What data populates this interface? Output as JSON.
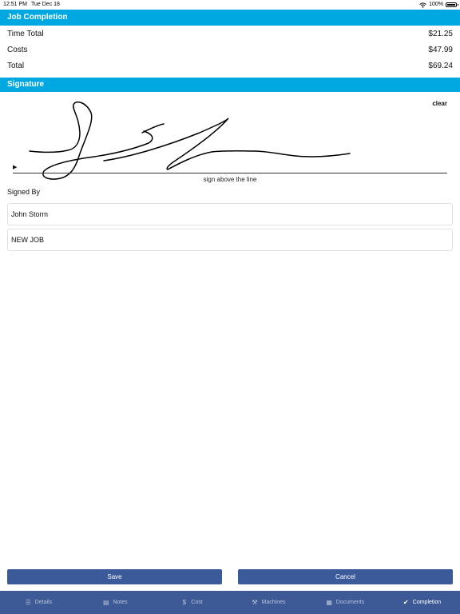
{
  "status_bar": {
    "time": "12:51 PM",
    "date": "Tue Dec 18",
    "battery": "100%"
  },
  "job_completion": {
    "title": "Job Completion",
    "rows": [
      {
        "label": "Time Total",
        "value": "$21.25"
      },
      {
        "label": "Costs",
        "value": "$47.99"
      },
      {
        "label": "Total",
        "value": "$69.24"
      }
    ]
  },
  "signature": {
    "title": "Signature",
    "clear_label": "clear",
    "marker": "▶",
    "hint": "sign above the line"
  },
  "signed_by": {
    "label": "Signed By",
    "name_value": "John Storm",
    "job_value": "NEW JOB"
  },
  "actions": {
    "save_label": "Save",
    "cancel_label": "Cancel"
  },
  "tabs": [
    {
      "label": "Details",
      "icon": "list-icon",
      "glyph": "☰"
    },
    {
      "label": "Notes",
      "icon": "notes-icon",
      "glyph": "▤"
    },
    {
      "label": "Cost",
      "icon": "dollar-icon",
      "glyph": "$"
    },
    {
      "label": "Machines",
      "icon": "wrench-icon",
      "glyph": "⚒"
    },
    {
      "label": "Documents",
      "icon": "document-icon",
      "glyph": "▦"
    },
    {
      "label": "Completion",
      "icon": "checkmark-icon",
      "glyph": "✔"
    }
  ],
  "active_tab": "Completion",
  "colors": {
    "section_header": "#00a8e2",
    "button": "#3a5a9a",
    "tab_bar": "#3d5a96"
  }
}
